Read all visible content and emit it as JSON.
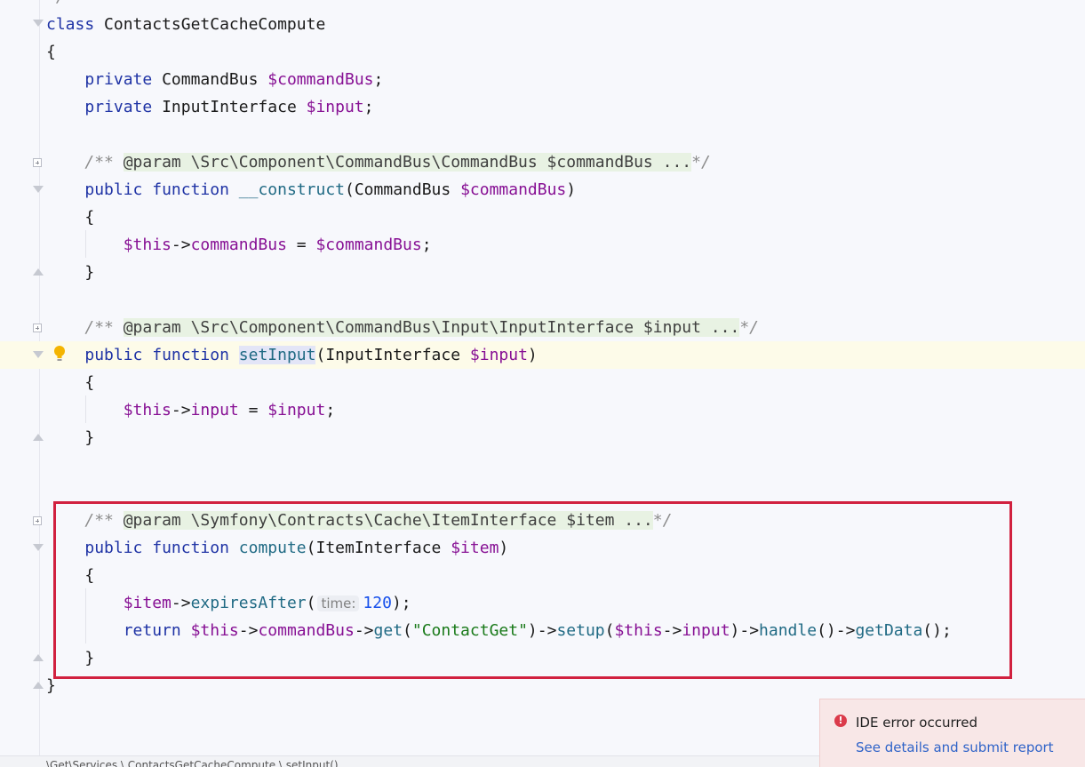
{
  "code": {
    "l_top": "*/",
    "l_class": {
      "kw": "class",
      "name": "ContactsGetCacheCompute"
    },
    "l_open": "{",
    "l_prop1": {
      "kw": "private",
      "type": "CommandBus",
      "var": "$commandBus",
      "end": ";"
    },
    "l_prop2": {
      "kw": "private",
      "type": "InputInterface",
      "var": "$input",
      "end": ";"
    },
    "l_doc1": {
      "open": "/**",
      "tag": "@param",
      "rest": "\\Src\\Component\\CommandBus\\CommandBus $commandBus ...",
      "close": "*/"
    },
    "l_ctor": {
      "kw1": "public",
      "kw2": "function",
      "name": "__construct",
      "open": "(",
      "type": "CommandBus",
      "var": "$commandBus",
      "close": ")"
    },
    "l_ctor_open": "{",
    "l_ctor_body": {
      "this": "$this",
      "arrow": "->",
      "field": "commandBus",
      "eq": " = ",
      "var": "$commandBus",
      "end": ";"
    },
    "l_ctor_close": "}",
    "l_doc2": {
      "open": "/**",
      "tag": "@param",
      "rest": "\\Src\\Component\\CommandBus\\Input\\InputInterface $input ...",
      "close": "*/"
    },
    "l_set": {
      "kw1": "public",
      "kw2": "function",
      "name": "setInput",
      "open": "(",
      "type": "InputInterface",
      "var": "$input",
      "close": ")"
    },
    "l_set_open": "{",
    "l_set_body": {
      "this": "$this",
      "arrow": "->",
      "field": "input",
      "eq": " = ",
      "var": "$input",
      "end": ";"
    },
    "l_set_close": "}",
    "l_doc3": {
      "open": "/**",
      "tag": "@param",
      "rest": "\\Symfony\\Contracts\\Cache\\ItemInterface $item ...",
      "close": "*/"
    },
    "l_compute": {
      "kw1": "public",
      "kw2": "function",
      "name": "compute",
      "open": "(",
      "type": "ItemInterface",
      "var": "$item",
      "close": ")"
    },
    "l_compute_open": "{",
    "l_exp": {
      "var": "$item",
      "arrow": "->",
      "method": "expiresAfter",
      "open": "(",
      "hint": "time:",
      "num": "120",
      "close": ");"
    },
    "l_ret": {
      "kw": "return",
      "this": "$this",
      "a1": "->",
      "f1": "commandBus",
      "a2": "->",
      "m1": "get",
      "p1": "(",
      "str": "\"ContactGet\"",
      "p2": ")->",
      "m2": "setup",
      "p3": "(",
      "this2": "$this",
      "a3": "->",
      "f2": "input",
      "p4": ")->",
      "m3": "handle",
      "p5": "()->",
      "m4": "getData",
      "p6": "();"
    },
    "l_compute_close": "}",
    "l_class_close": "}"
  },
  "statusbar": {
    "breadcrumb": "\\Get\\Services \\ ContactsGetCacheCompute \\ setInput()"
  },
  "notification": {
    "title": "IDE error occurred",
    "link": "See details and submit report"
  },
  "icons": {
    "error": "error-icon",
    "intention": "lightbulb-icon"
  },
  "colors": {
    "keyword": "#1f33a5",
    "variable": "#871094",
    "method": "#206a84",
    "string": "#1a7a1a",
    "number": "#1750eb",
    "highlight_box": "#d1213f",
    "error": "#db3b4b",
    "link": "#2f63c8"
  }
}
